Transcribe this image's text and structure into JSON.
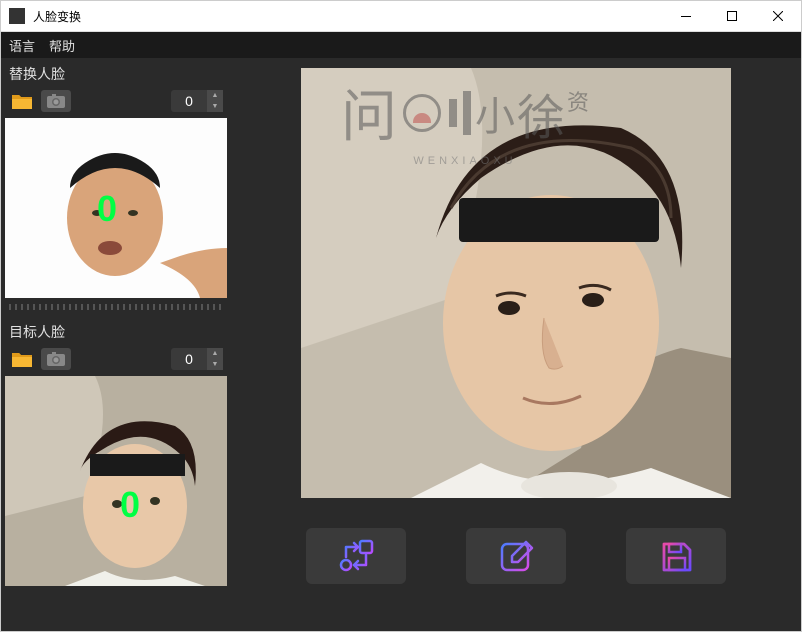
{
  "window": {
    "title": "人脸变换"
  },
  "menu": {
    "language": "语言",
    "help": "帮助"
  },
  "source": {
    "label": "替换人脸",
    "counter": "0",
    "face_marker": "0"
  },
  "target": {
    "label": "目标人脸",
    "counter": "0",
    "face_marker": "0"
  },
  "watermark": {
    "text_chars": [
      "问",
      "小",
      "徐"
    ],
    "sub_chars": "资",
    "latin": "WENXIAOXU"
  },
  "actions": {
    "swap": "swap",
    "edit": "edit",
    "save": "save"
  }
}
